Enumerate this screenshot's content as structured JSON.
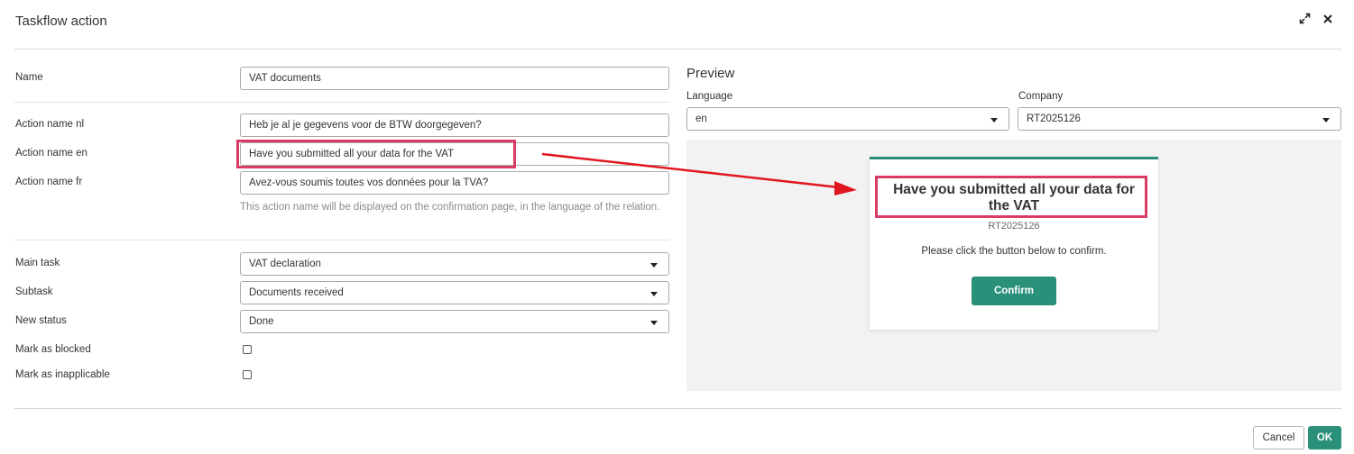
{
  "dialog": {
    "title": "Taskflow action",
    "expand_icon": "expand-arrows-icon",
    "close_icon": "close-icon"
  },
  "form": {
    "name_label": "Name",
    "name_value": "VAT documents",
    "action_nl_label": "Action name nl",
    "action_nl_value": "Heb je al je gegevens voor de BTW doorgegeven?",
    "action_en_label": "Action name en",
    "action_en_value": "Have you submitted all your data for the VAT",
    "action_fr_label": "Action name fr",
    "action_fr_value": "Avez-vous soumis toutes vos données pour la TVA?",
    "action_hint": "This action name will be displayed on the confirmation page, in the language of the relation.",
    "main_task_label": "Main task",
    "main_task_value": "VAT declaration",
    "subtask_label": "Subtask",
    "subtask_value": "Documents received",
    "new_status_label": "New status",
    "new_status_value": "Done",
    "mark_blocked_label": "Mark as blocked",
    "mark_blocked_checked": false,
    "mark_inapplicable_label": "Mark as inapplicable",
    "mark_inapplicable_checked": false
  },
  "preview": {
    "title": "Preview",
    "language_label": "Language",
    "language_value": "en",
    "company_label": "Company",
    "company_value": "RT2025126",
    "card": {
      "title": "Have you submitted all your data for the VAT",
      "company": "RT2025126",
      "message": "Please click the button below to confirm.",
      "confirm_label": "Confirm"
    }
  },
  "footer": {
    "cancel_label": "Cancel",
    "ok_label": "OK"
  },
  "colors": {
    "accent": "#2a9079",
    "annotation": "#d83b64",
    "arrow": "#e0161f"
  }
}
